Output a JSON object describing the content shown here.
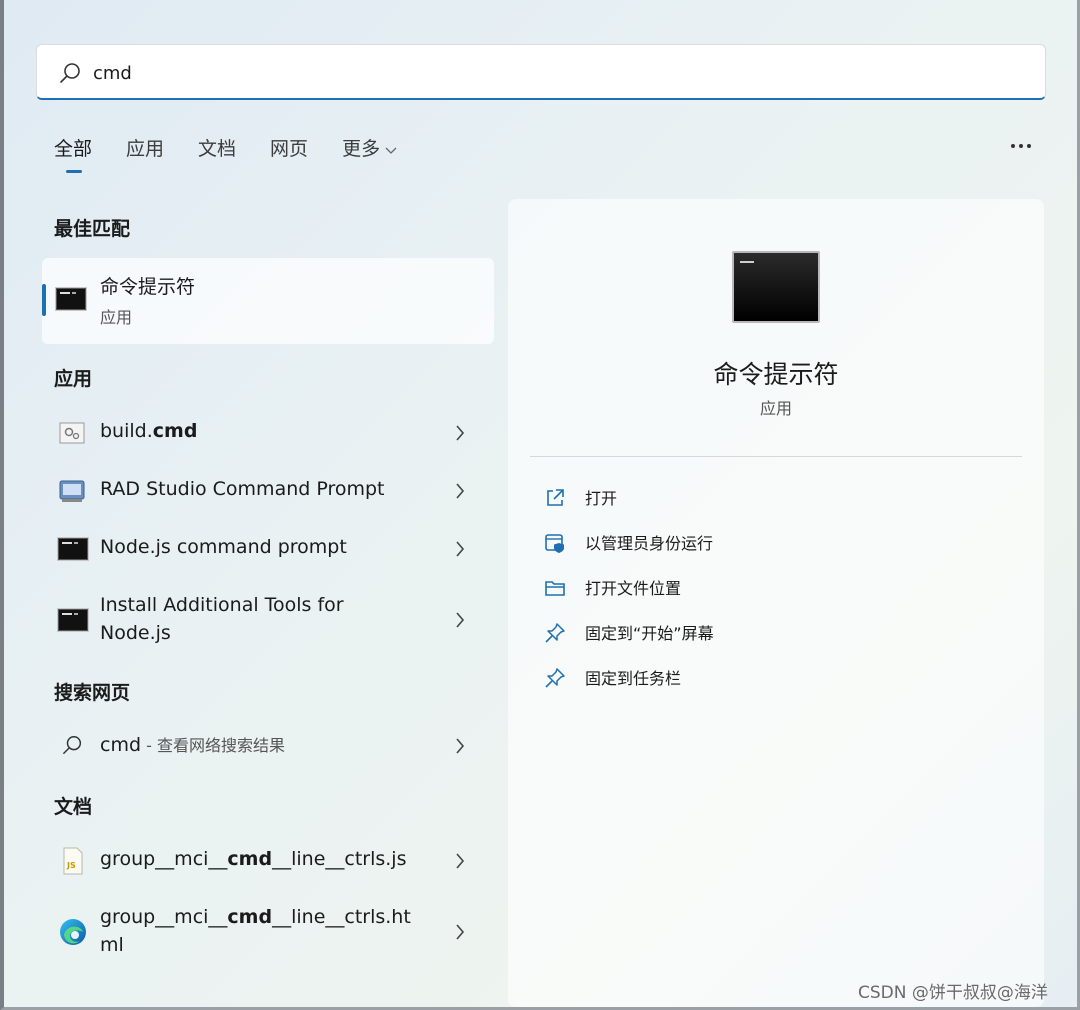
{
  "search": {
    "value": "cmd"
  },
  "tabs": [
    {
      "label": "全部"
    },
    {
      "label": "应用"
    },
    {
      "label": "文档"
    },
    {
      "label": "网页"
    },
    {
      "label": "更多"
    }
  ],
  "more_icon": "ellipsis-icon",
  "sections": {
    "best_match": "最佳匹配",
    "apps": "应用",
    "web": "搜索网页",
    "docs": "文档"
  },
  "best_match": {
    "title": "命令提示符",
    "subtitle": "应用"
  },
  "apps": [
    {
      "prefix": "build.",
      "bold": "cmd",
      "suffix": "",
      "icon": "settings-script-icon"
    },
    {
      "prefix": "RAD Studio Command Prompt",
      "bold": "",
      "suffix": "",
      "icon": "rad-studio-icon"
    },
    {
      "prefix": "Node.js command prompt",
      "bold": "",
      "suffix": "",
      "icon": "cmd-icon"
    },
    {
      "line1": "Install Additional Tools for",
      "line2": "Node.js",
      "icon": "cmd-icon"
    }
  ],
  "web": {
    "term": "cmd",
    "hint": " - 查看网络搜索结果"
  },
  "docs": [
    {
      "pre": "group__mci__",
      "bold": "cmd",
      "post": "__line__ctrls.js",
      "icon": "js-file-icon"
    },
    {
      "pre": "group__mci__",
      "bold": "cmd",
      "post": "__line__ctrls.ht",
      "line2": "ml",
      "icon": "edge-icon"
    }
  ],
  "panel": {
    "title": "命令提示符",
    "subtitle": "应用",
    "actions": [
      {
        "label": "打开",
        "icon": "open-external-icon"
      },
      {
        "label": "以管理员身份运行",
        "icon": "run-as-admin-icon"
      },
      {
        "label": "打开文件位置",
        "icon": "folder-icon"
      },
      {
        "label": "固定到“开始”屏幕",
        "icon": "pin-icon"
      },
      {
        "label": "固定到任务栏",
        "icon": "pin-icon"
      }
    ]
  },
  "watermark": "CSDN @饼干叔叔@海洋",
  "colors": {
    "accent": "#1f6fb2"
  }
}
